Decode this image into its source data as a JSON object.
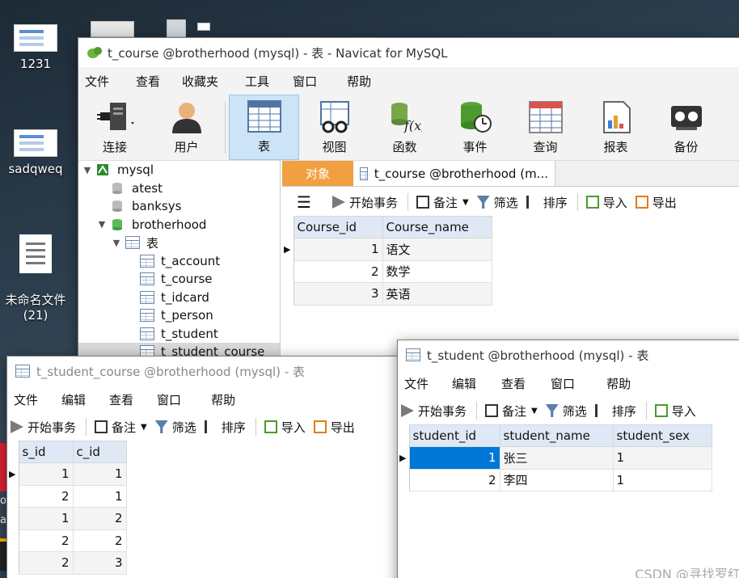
{
  "desktop": {
    "icons": [
      {
        "label": "1231"
      },
      {
        "label": "sadqweq"
      },
      {
        "label": "未命名文件\n(21)"
      }
    ],
    "left_edge_text": [
      "o",
      "a"
    ]
  },
  "main": {
    "title": "t_course @brotherhood (mysql) - 表 - Navicat for MySQL",
    "menu": [
      "文件",
      "查看",
      "收藏夹",
      "工具",
      "窗口",
      "帮助"
    ],
    "toolbar": [
      {
        "label": "连接",
        "icon": "plug-icon"
      },
      {
        "label": "用户",
        "icon": "user-icon"
      },
      {
        "label": "表",
        "icon": "table-icon",
        "active": true
      },
      {
        "label": "视图",
        "icon": "view-icon"
      },
      {
        "label": "函数",
        "icon": "function-icon"
      },
      {
        "label": "事件",
        "icon": "event-icon"
      },
      {
        "label": "查询",
        "icon": "query-icon"
      },
      {
        "label": "报表",
        "icon": "report-icon"
      },
      {
        "label": "备份",
        "icon": "backup-icon"
      }
    ],
    "tree": {
      "connection": "mysql",
      "databases": [
        "atest",
        "banksys",
        "brotherhood"
      ],
      "tables_folder": "表",
      "tables": [
        "t_account",
        "t_course",
        "t_idcard",
        "t_person",
        "t_student",
        "t_student_course"
      ]
    },
    "tabs": {
      "objects": "对象",
      "current": "t_course @brotherhood (m..."
    },
    "subtoolbar": {
      "begin": "开始事务",
      "memo": "备注",
      "filter": "筛选",
      "sort": "排序",
      "import": "导入",
      "export": "导出"
    },
    "grid": {
      "columns": [
        "Course_id",
        "Course_name"
      ],
      "rows": [
        [
          "1",
          "语文"
        ],
        [
          "2",
          "数学"
        ],
        [
          "3",
          "英语"
        ]
      ]
    }
  },
  "student_course": {
    "title": "t_student_course @brotherhood (mysql) - 表",
    "menu": [
      "文件",
      "编辑",
      "查看",
      "窗口",
      "帮助"
    ],
    "subtoolbar": {
      "begin": "开始事务",
      "memo": "备注",
      "filter": "筛选",
      "sort": "排序",
      "import": "导入",
      "export": "导出"
    },
    "grid": {
      "columns": [
        "s_id",
        "c_id"
      ],
      "rows": [
        [
          "1",
          "1"
        ],
        [
          "2",
          "1"
        ],
        [
          "1",
          "2"
        ],
        [
          "2",
          "2"
        ],
        [
          "2",
          "3"
        ]
      ]
    }
  },
  "student": {
    "title": "t_student @brotherhood (mysql) - 表",
    "menu": [
      "文件",
      "编辑",
      "查看",
      "窗口",
      "帮助"
    ],
    "subtoolbar": {
      "begin": "开始事务",
      "memo": "备注",
      "filter": "筛选",
      "sort": "排序",
      "import": "导入"
    },
    "grid": {
      "columns": [
        "student_id",
        "student_name",
        "student_sex"
      ],
      "rows": [
        [
          "1",
          "张三",
          "1"
        ],
        [
          "2",
          "李四",
          "1"
        ]
      ]
    }
  },
  "watermark": "CSDN @寻找罗红",
  "colors": {
    "accent": "#0078d7",
    "objects_tab": "#f0a040",
    "header": "#dfe9f5",
    "active_tool": "#cde3f7"
  }
}
